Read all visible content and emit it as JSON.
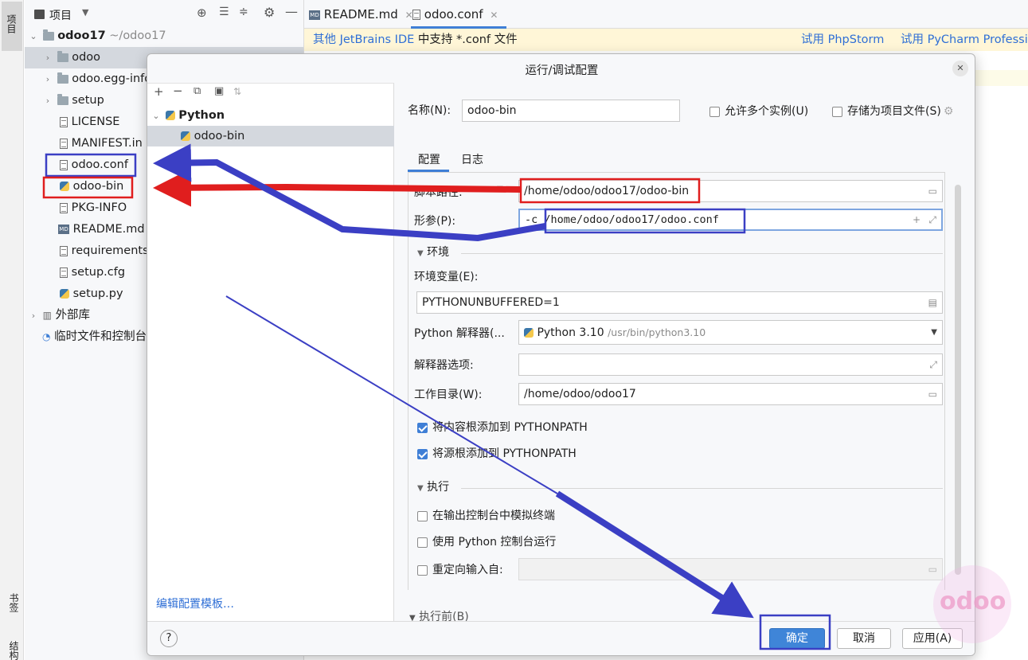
{
  "left_stripe": {
    "project_tab": "项目",
    "bookmarks_tab": "书签",
    "structure_tab": "结构"
  },
  "project_panel": {
    "title": "项目",
    "root": {
      "name": "odoo17",
      "path": "~/odoo17"
    },
    "items": [
      {
        "label": "odoo",
        "kind": "folder"
      },
      {
        "label": "odoo.egg-info",
        "kind": "folder"
      },
      {
        "label": "setup",
        "kind": "folder"
      },
      {
        "label": "LICENSE",
        "kind": "file"
      },
      {
        "label": "MANIFEST.in",
        "kind": "file"
      },
      {
        "label": "odoo.conf",
        "kind": "file"
      },
      {
        "label": "odoo-bin",
        "kind": "python"
      },
      {
        "label": "PKG-INFO",
        "kind": "file"
      },
      {
        "label": "README.md",
        "kind": "md"
      },
      {
        "label": "requirements",
        "kind": "file"
      },
      {
        "label": "setup.cfg",
        "kind": "file"
      },
      {
        "label": "setup.py",
        "kind": "python"
      }
    ],
    "external_libs": "外部库",
    "scratches": "临时文件和控制台"
  },
  "editor": {
    "tabs": [
      {
        "label": "README.md"
      },
      {
        "label": "odoo.conf"
      }
    ],
    "banner": {
      "text_prefix": "其他 JetBrains IDE",
      "text_suffix": " 中支持 *.conf 文件",
      "link1": "试用 PhpStorm",
      "link2": "试用 PyCharm Professio"
    }
  },
  "dialog": {
    "title": "运行/调试配置",
    "tree": {
      "group": "Python",
      "item": "odoo-bin"
    },
    "edit_templates": "编辑配置模板…",
    "name_label": "名称(N):",
    "name_value": "odoo-bin",
    "allow_parallel": "允许多个实例(U)",
    "store_as_file": "存储为项目文件(S)",
    "tabs": {
      "config": "配置",
      "logs": "日志"
    },
    "script_label": "脚本路径:",
    "script_value": "/home/odoo/odoo17/odoo-bin",
    "params_label": "形参(P):",
    "params_prefix": "-c ",
    "params_value": "/home/odoo/odoo17/odoo.conf",
    "env_section": "环境",
    "env_vars_label": "环境变量(E):",
    "env_vars_value": "PYTHONUNBUFFERED=1",
    "interpreter_label": "Python 解释器(...",
    "interpreter_name": "Python 3.10",
    "interpreter_path": "/usr/bin/python3.10",
    "interp_opts_label": "解释器选项:",
    "workdir_label": "工作目录(W):",
    "workdir_value": "/home/odoo/odoo17",
    "add_content_roots": "将内容根添加到 PYTHONPATH",
    "add_source_roots": "将源根添加到 PYTHONPATH",
    "exec_section": "执行",
    "emulate_terminal": "在输出控制台中模拟终端",
    "run_with_console": "使用 Python 控制台运行",
    "redirect_input": "重定向输入自:",
    "before_launch": "执行前(B)",
    "help": "?",
    "ok": "确定",
    "cancel": "取消",
    "apply": "应用(A)"
  },
  "watermark": "odoo",
  "colors": {
    "red_highlight": "#e01e1e",
    "blue_highlight": "#3b3fc4",
    "primary_button": "#3f85d8",
    "banner_bg": "#fff6d7",
    "link": "#2f6fd6"
  }
}
